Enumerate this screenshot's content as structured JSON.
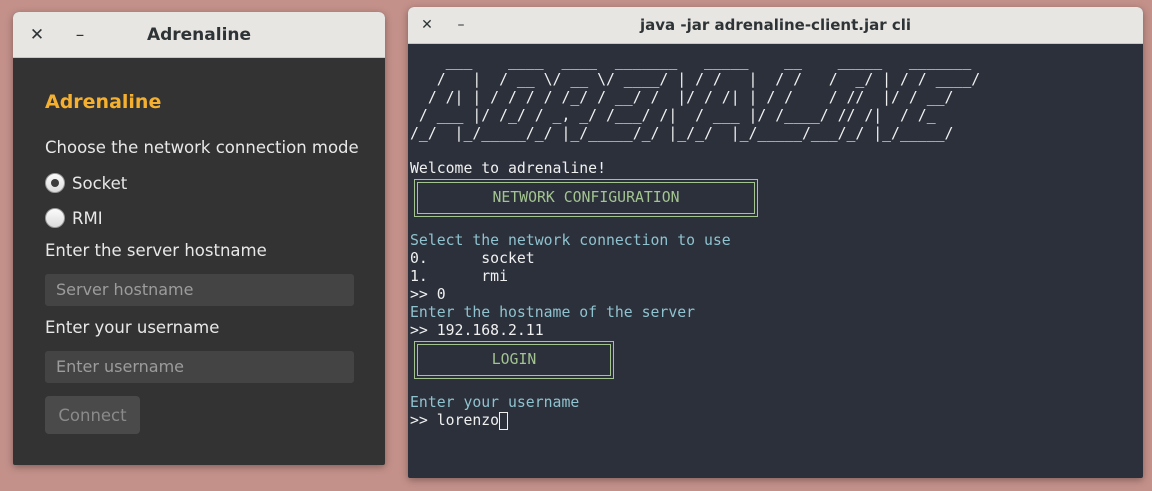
{
  "gui": {
    "window_title": "Adrenaline",
    "close_glyph": "✕",
    "minimize_glyph": "–",
    "app_title": "Adrenaline",
    "mode_prompt": "Choose the network connection mode",
    "options": [
      {
        "label": "Socket",
        "selected": true
      },
      {
        "label": "RMI",
        "selected": false
      }
    ],
    "hostname_prompt": "Enter the server hostname",
    "hostname_placeholder": "Server hostname",
    "username_prompt": "Enter your username",
    "username_placeholder": "Enter username",
    "connect_label": "Connect"
  },
  "terminal": {
    "window_title": "java -jar adrenaline-client.jar cli",
    "close_glyph": "✕",
    "minimize_glyph": "–",
    "ascii_art": [
      "    ___    ____  ____  _______   _____    __    _____   _______",
      "   /   |  / __ \\/ __ \\/ ____/ | / /   |  / /   /  _/ | / / ____/",
      "  / /| | / / / / /_/ / __/ /  |/ / /| | / /    / //  |/ / __/",
      " / ___ |/ /_/ / _, _/ /___/ /|  / ___ |/ /____/ // /|  / /_",
      "/_/  |_/_____/_/ |_/_____/_/ |_/_/  |_/_____/___/_/ |_/_____/"
    ],
    "welcome": "Welcome to adrenaline!",
    "network_header": "NETWORK CONFIGURATION",
    "select_prompt": "Select the network connection to use",
    "option_lines": [
      "0.      socket",
      "1.      rmi"
    ],
    "input_choice": ">> 0",
    "hostname_prompt": "Enter the hostname of the server",
    "input_hostname": ">> 192.168.2.11",
    "login_header": "LOGIN",
    "username_prompt": "Enter your username",
    "input_username": ">> lorenzo"
  },
  "colors": {
    "accent": "#f5b02f",
    "terminal_bg": "#2b303b",
    "terminal_cyan": "#8fc3cf",
    "terminal_green": "#a3c390",
    "gui_bg": "#333333"
  }
}
